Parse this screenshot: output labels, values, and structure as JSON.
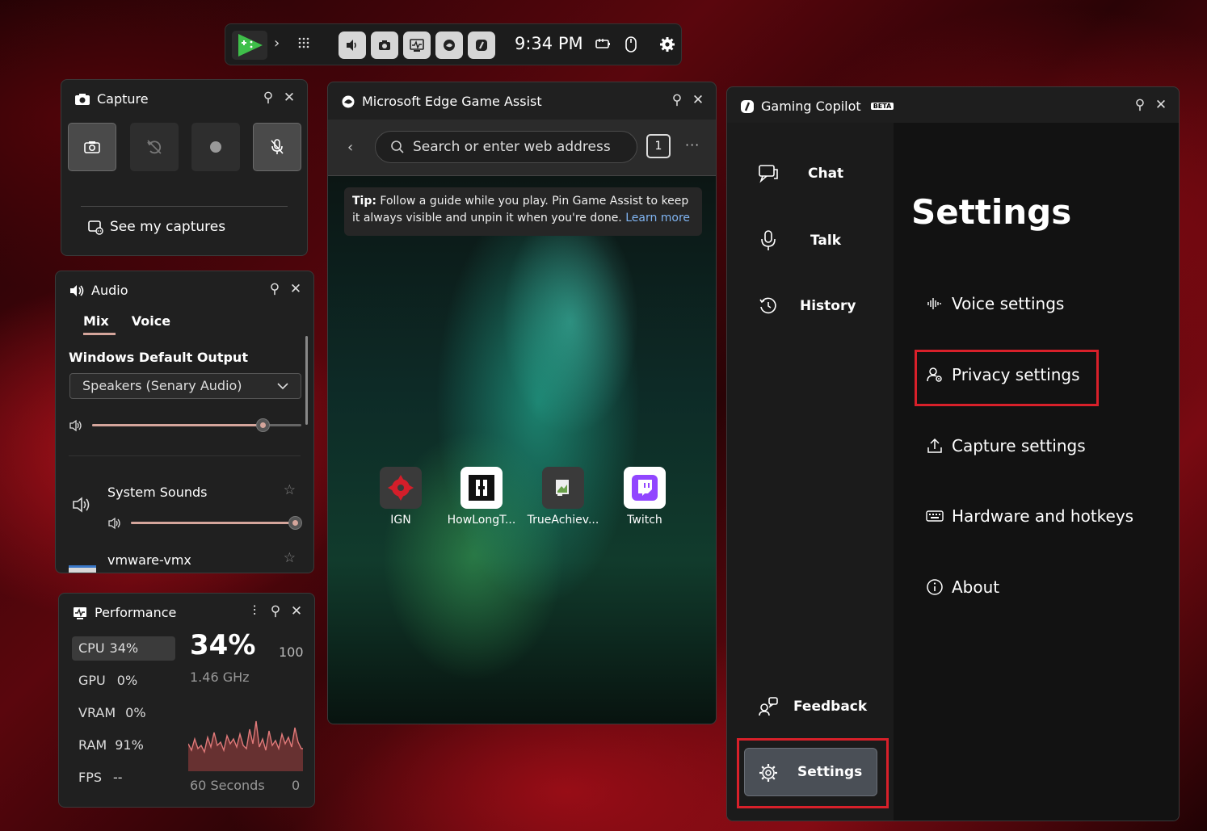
{
  "topbar": {
    "time": "9:34 PM",
    "buttons": [
      "audio-icon",
      "capture-icon",
      "performance-icon",
      "edge-icon",
      "copilot-icon"
    ]
  },
  "capture": {
    "title": "Capture",
    "see_captures": "See my captures"
  },
  "audio": {
    "title": "Audio",
    "tabs": [
      "Mix",
      "Voice"
    ],
    "output_heading": "Windows Default Output",
    "output_device": "Speakers (Senary Audio)",
    "master_volume": 0.82,
    "apps": [
      {
        "name": "System Sounds",
        "volume": 1.0
      },
      {
        "name": "vmware-vmx"
      }
    ]
  },
  "performance": {
    "title": "Performance",
    "metrics": [
      {
        "label": "CPU",
        "value": "34%"
      },
      {
        "label": "GPU",
        "value": "0%"
      },
      {
        "label": "VRAM",
        "value": "0%"
      },
      {
        "label": "RAM",
        "value": "91%"
      },
      {
        "label": "FPS",
        "value": "--"
      }
    ],
    "big_value": "34%",
    "max": "100",
    "freq": "1.46 GHz",
    "window": "60 Seconds",
    "min": "0"
  },
  "edge": {
    "title": "Microsoft Edge Game Assist",
    "address_placeholder": "Search or enter web address",
    "tab_count": "1",
    "tip_bold": "Tip:",
    "tip_text": " Follow a guide while you play. Pin Game Assist to keep it always visible and unpin it when you're done. ",
    "tip_link": "Learn more",
    "tiles": [
      "IGN",
      "HowLongT...",
      "TrueAchiev...",
      "Twitch"
    ]
  },
  "copilot": {
    "title": "Gaming Copilot",
    "badge": "BETA",
    "nav": [
      "Chat",
      "Talk",
      "History"
    ],
    "feedback": "Feedback",
    "settings_btn": "Settings",
    "settings_title": "Settings",
    "items": [
      "Voice settings",
      "Privacy settings",
      "Capture settings",
      "Hardware and hotkeys",
      "About"
    ]
  },
  "colors": {
    "accent": "#d4a59b",
    "highlight": "#d8202a",
    "link": "#7fb3f0"
  }
}
